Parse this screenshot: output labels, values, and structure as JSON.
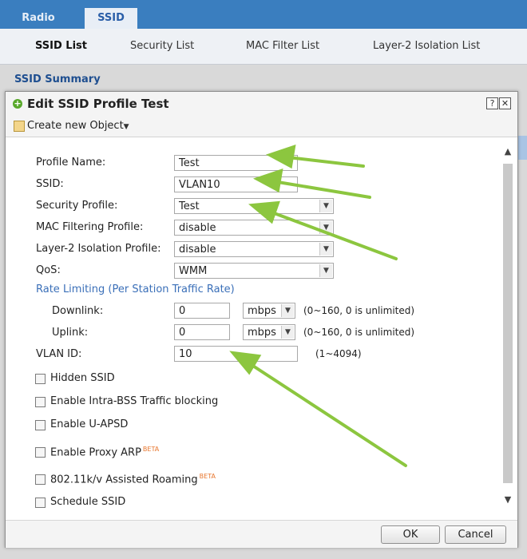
{
  "top_tabs": {
    "radio": "Radio",
    "ssid": "SSID"
  },
  "sub_tabs": [
    "SSID List",
    "Security List",
    "MAC Filter List",
    "Layer-2 Isolation List"
  ],
  "summary_title": "SSID Summary",
  "dialog": {
    "title": "Edit SSID Profile Test",
    "help_icon": "?",
    "close_icon": "✕",
    "create_label": "Create new Object",
    "form": {
      "profile_name_label": "Profile Name:",
      "profile_name_value": "Test",
      "ssid_label": "SSID:",
      "ssid_value": "VLAN10",
      "security_profile_label": "Security Profile:",
      "security_profile_value": "Test",
      "mac_filtering_label": "MAC Filtering Profile:",
      "mac_filtering_value": "disable",
      "layer2_label": "Layer-2 Isolation Profile:",
      "layer2_value": "disable",
      "qos_label": "QoS:",
      "qos_value": "WMM",
      "rate_limit_heading": "Rate Limiting (Per Station Traffic Rate)",
      "downlink_label": "Downlink:",
      "downlink_value": "0",
      "downlink_unit": "mbps",
      "downlink_hint": "(0~160, 0 is unlimited)",
      "uplink_label": "Uplink:",
      "uplink_value": "0",
      "uplink_unit": "mbps",
      "uplink_hint": "(0~160, 0 is unlimited)",
      "vlan_label": "VLAN ID:",
      "vlan_value": "10",
      "vlan_hint": "(1~4094)",
      "hidden_ssid": "Hidden SSID",
      "intra_bss": "Enable Intra-BSS Traffic blocking",
      "u_apsd": "Enable U-APSD",
      "proxy_arp": "Enable Proxy ARP",
      "roaming": "802.11k/v Assisted Roaming",
      "beta": "BETA",
      "schedule": "Schedule SSID"
    },
    "ok": "OK",
    "cancel": "Cancel"
  },
  "colors": {
    "accent": "#3a7ebf",
    "arrow": "#8cc63f"
  }
}
